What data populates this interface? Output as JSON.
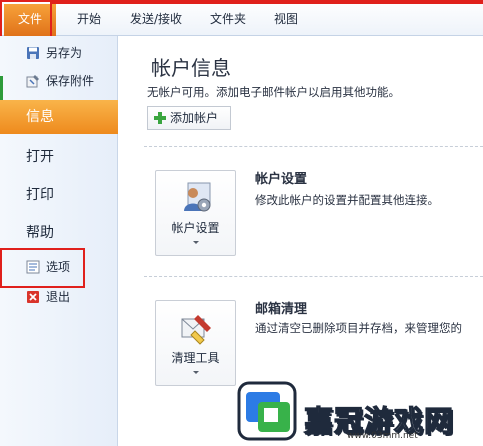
{
  "ribbon": {
    "tabs": [
      {
        "label": "文件"
      },
      {
        "label": "开始"
      },
      {
        "label": "发送/接收"
      },
      {
        "label": "文件夹"
      },
      {
        "label": "视图"
      }
    ]
  },
  "sidebar": {
    "items": [
      {
        "label": "另存为",
        "icon": "save-as-icon"
      },
      {
        "label": "保存附件",
        "icon": "save-attachment-icon"
      },
      {
        "label": "信息",
        "selected": true
      },
      {
        "label": "打开"
      },
      {
        "label": "打印"
      },
      {
        "label": "帮助"
      },
      {
        "label": "选项",
        "icon": "options-icon"
      },
      {
        "label": "退出",
        "icon": "exit-icon"
      }
    ]
  },
  "main": {
    "title": "帐户信息",
    "description": "无帐户可用。添加电子邮件帐户以启用其他功能。",
    "add_account_label": "添加帐户",
    "sections": [
      {
        "button_label": "帐户设置",
        "title": "帐户设置",
        "description": "修改此帐户的设置并配置其他连接。"
      },
      {
        "button_label": "清理工具",
        "title": "邮箱清理",
        "description": "通过清空已删除项目并存档，来管理您的"
      }
    ]
  },
  "watermark": {
    "text": "嘉冠游戏网",
    "url": "www.03mm.net"
  },
  "colors": {
    "highlight_red": "#e0201c",
    "file_tab_orange": "#e0721a",
    "selected_orange": "#ee8a1d",
    "sidebar_bg": "#e6eef9"
  }
}
